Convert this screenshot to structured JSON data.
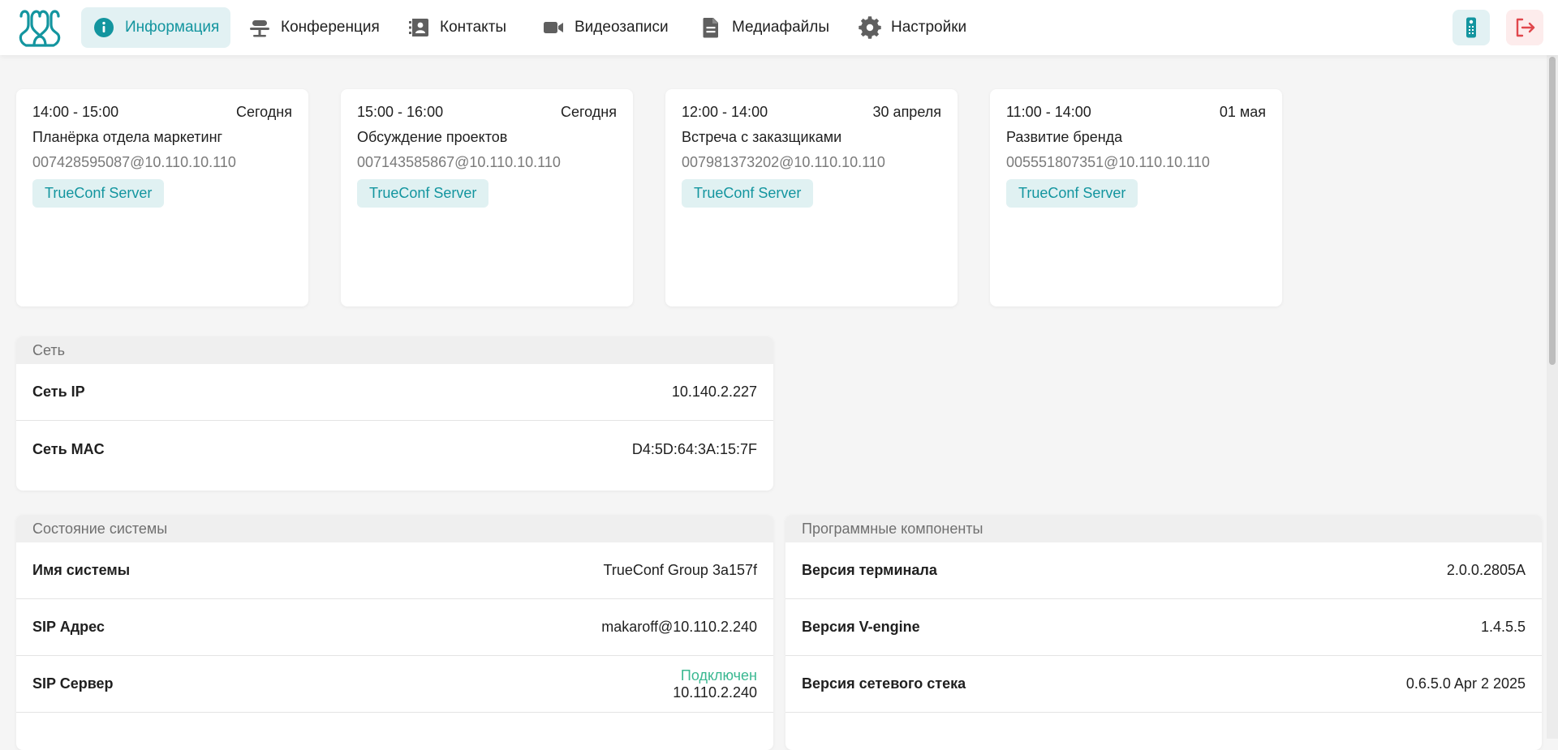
{
  "nav": {
    "items": [
      {
        "label": "Информация",
        "icon": "info-icon",
        "active": true
      },
      {
        "label": "Конференция",
        "icon": "conference-icon",
        "active": false
      },
      {
        "label": "Контакты",
        "icon": "contacts-icon",
        "active": false
      },
      {
        "label": "Видеозаписи",
        "icon": "video-camera-icon",
        "active": false
      },
      {
        "label": "Медиафайлы",
        "icon": "document-icon",
        "active": false
      },
      {
        "label": "Настройки",
        "icon": "gear-icon",
        "active": false
      }
    ],
    "remote_icon": "remote-control-icon",
    "logout_icon": "logout-icon"
  },
  "conferences": [
    {
      "time": "14:00 - 15:00",
      "date": "Сегодня",
      "title": "Планёрка отдела маркетинг",
      "address": "007428595087@10.110.10.110",
      "server": "TrueConf Server"
    },
    {
      "time": "15:00 - 16:00",
      "date": "Сегодня",
      "title": "Обсуждение проектов",
      "address": "007143585867@10.110.10.110",
      "server": "TrueConf Server"
    },
    {
      "time": "12:00 - 14:00",
      "date": "30 апреля",
      "title": "Встреча с заказщиками",
      "address": "007981373202@10.110.10.110",
      "server": "TrueConf Server"
    },
    {
      "time": "11:00 - 14:00",
      "date": "01 мая",
      "title": "Развитие бренда",
      "address": "005551807351@10.110.10.110",
      "server": "TrueConf Server"
    }
  ],
  "network": {
    "header": "Сеть",
    "rows": [
      {
        "label": "Сеть IP",
        "value": "10.140.2.227"
      },
      {
        "label": "Сеть MAC",
        "value": "D4:5D:64:3A:15:7F"
      }
    ]
  },
  "system": {
    "header": "Состояние системы",
    "rows": [
      {
        "label": "Имя системы",
        "value": "TrueConf Group 3a157f"
      },
      {
        "label": "SIP Адрес",
        "value": "makaroff@10.110.2.240"
      },
      {
        "label": "SIP Сервер",
        "status": "Подключен",
        "value": "10.110.2.240"
      }
    ]
  },
  "software": {
    "header": "Программные компоненты",
    "rows": [
      {
        "label": "Версия терминала",
        "value": "2.0.0.2805A"
      },
      {
        "label": "Версия V-engine",
        "value": "1.4.5.5"
      },
      {
        "label": "Версия сетевого стека",
        "value": "0.6.5.0 Apr 2 2025"
      }
    ]
  },
  "colors": {
    "accent": "#13959f",
    "accent_bg": "#e2f1f3",
    "status_ok": "#3ab891",
    "logout": "#e0474c"
  }
}
